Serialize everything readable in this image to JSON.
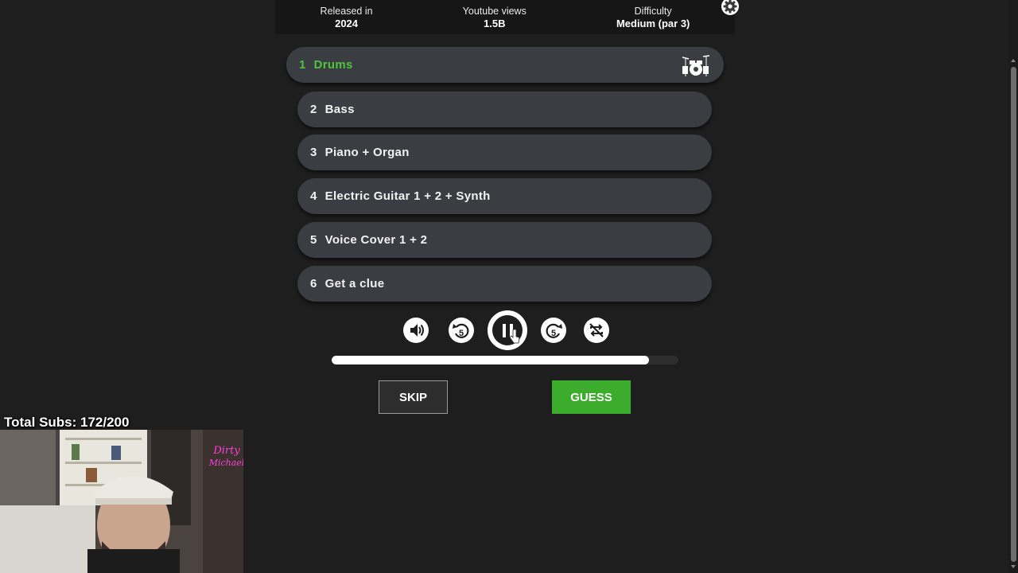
{
  "info": {
    "released_label": "Released in",
    "released_value": "2024",
    "views_label": "Youtube views",
    "views_value": "1.5B",
    "difficulty_label": "Difficulty",
    "difficulty_value": "Medium (par 3)"
  },
  "stems": [
    {
      "num": "1",
      "label": "Drums",
      "active": true
    },
    {
      "num": "2",
      "label": "Bass",
      "active": false
    },
    {
      "num": "3",
      "label": "Piano + Organ",
      "active": false
    },
    {
      "num": "4",
      "label": "Electric Guitar 1 + 2 + Synth",
      "active": false
    },
    {
      "num": "5",
      "label": "Voice Cover 1 + 2",
      "active": false
    },
    {
      "num": "6",
      "label": "Get a clue",
      "active": false
    }
  ],
  "controls": {
    "rewind_seconds": "5",
    "forward_seconds": "5"
  },
  "progress": {
    "fraction": 0.915
  },
  "buttons": {
    "skip_label": "SKIP",
    "guess_label": "GUESS"
  },
  "overlay": {
    "subs_text": "Total Subs: 172/200"
  },
  "colors": {
    "active_stem": "#52c341",
    "guess_button": "#3cac2c",
    "stem_background": "#3a3d41"
  }
}
